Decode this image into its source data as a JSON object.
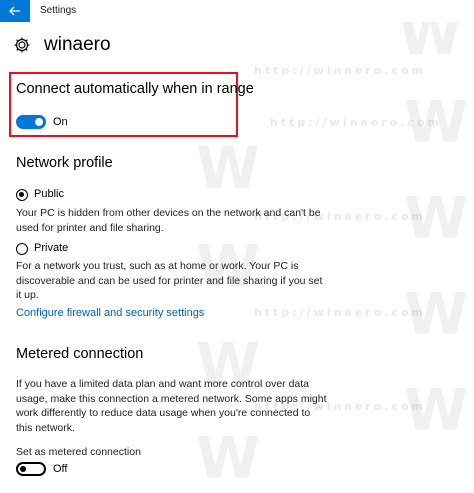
{
  "app": {
    "title": "Settings"
  },
  "page": {
    "title": "winaero"
  },
  "auto_connect": {
    "heading": "Connect automatically when in range",
    "state_label": "On",
    "state": true
  },
  "network_profile": {
    "heading": "Network profile",
    "public": {
      "label": "Public",
      "selected": true,
      "description_line1": "Your PC is hidden from other devices on the network and can't be",
      "description_line2": "used for printer and file sharing."
    },
    "private": {
      "label": "Private",
      "selected": false,
      "description_line1": "For a network you trust, such as at home or work. Your PC is",
      "description_line2": "discoverable and can be used for printer and file sharing if you set",
      "description_line3": "it up."
    },
    "firewall_link": "Configure firewall and security settings"
  },
  "metered": {
    "heading": "Metered connection",
    "description_line1": "If you have a limited data plan and want more control over data",
    "description_line2": "usage, make this connection a metered network. Some apps might",
    "description_line3": "work differently to reduce data usage when you're connected to",
    "description_line4": "this network.",
    "toggle_caption": "Set as metered connection",
    "state_label": "Off",
    "state": false
  },
  "watermark": {
    "letter": "W",
    "url": "http://winaero.com"
  },
  "colors": {
    "accent": "#0078d7",
    "highlight_border": "#e81123",
    "link": "#0063b1"
  },
  "icons": {
    "back": "back-arrow-icon",
    "settings": "gear-icon"
  }
}
